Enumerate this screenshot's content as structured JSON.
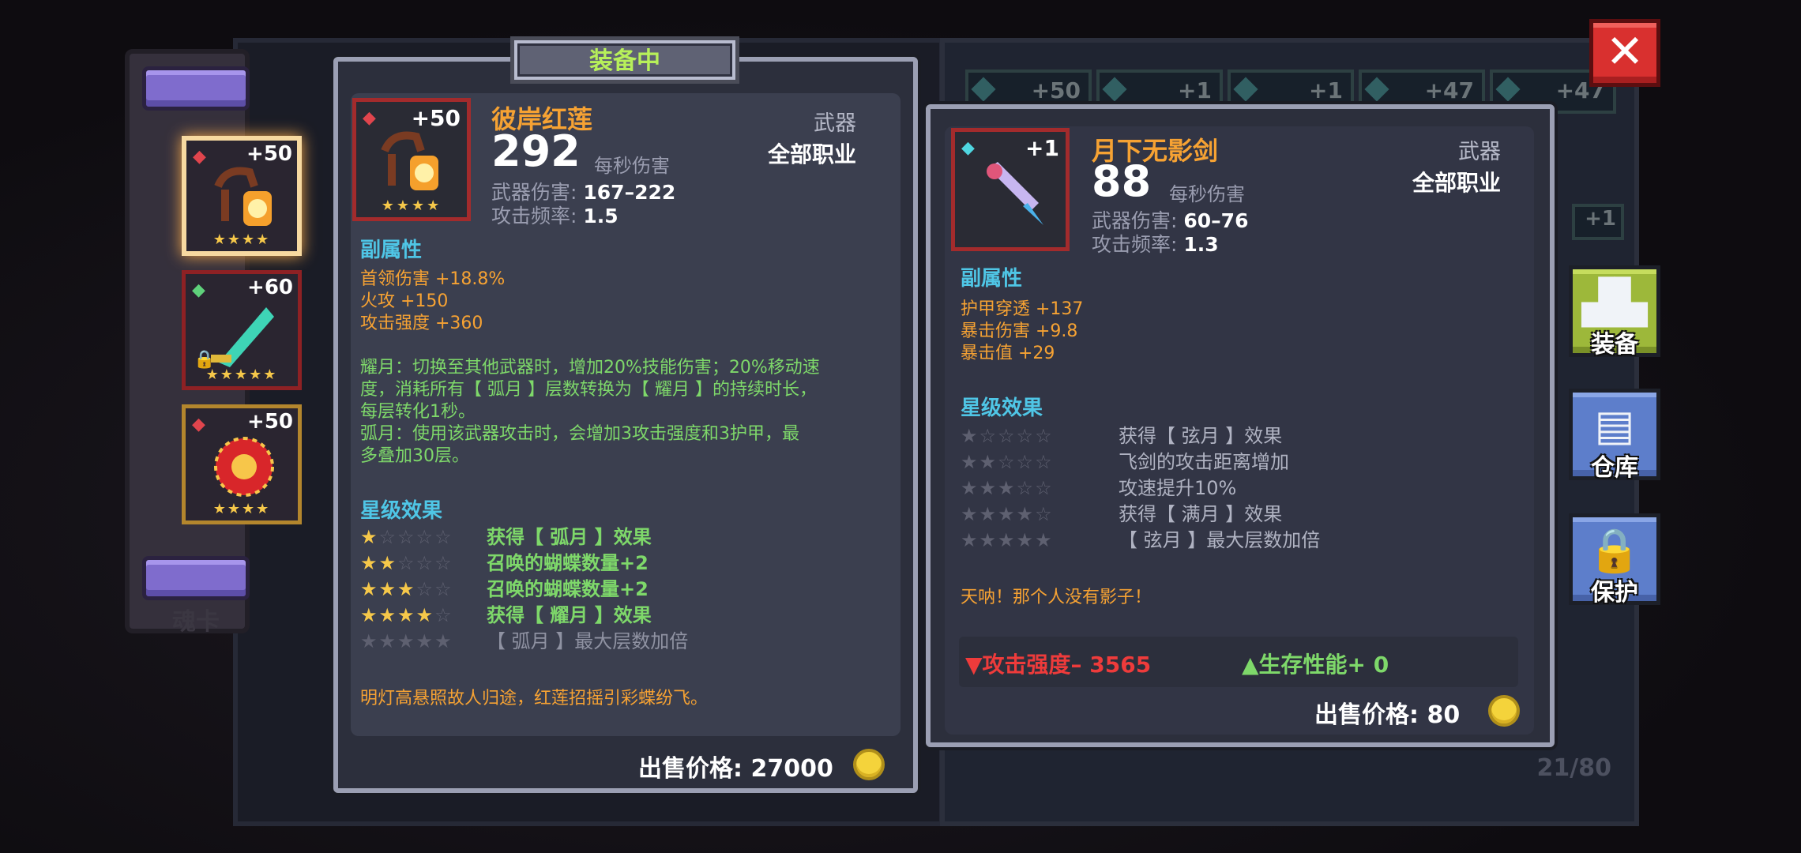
{
  "colors": {
    "orange": "#f6a233",
    "cyan": "#4fc6e6",
    "green": "#7ed86a",
    "red": "#ee3b3b",
    "gold": "#f6c84a"
  },
  "background": {
    "inventory_levels": [
      "+50",
      "+1",
      "+1",
      "+47",
      "+47"
    ],
    "side_level": "+1",
    "count": "21/80",
    "tab_label": "魂卡"
  },
  "slots": [
    {
      "level": "+50",
      "gem": "red-gem-icon",
      "stars": "★★★★",
      "icon": "lantern-staff-icon"
    },
    {
      "level": "+60",
      "gem": "green-gem-icon",
      "stars": "★★★★★",
      "icon": "jade-sword-icon"
    },
    {
      "level": "+50",
      "gem": "red-gem-icon",
      "stars": "★★★★",
      "icon": "red-orb-icon"
    }
  ],
  "equipped": {
    "header": "装备中",
    "name": "彼岸红莲",
    "level": "+50",
    "stars": "★★★★",
    "dps": "292",
    "dps_label": "每秒伤害",
    "damage_label": "武器伤害:",
    "damage": "167–222",
    "rate_label": "攻击频率:",
    "rate": "1.5",
    "type": "武器",
    "class": "全部职业",
    "sub_title": "副属性",
    "sub_attrs": [
      "首领伤害 +18.8%",
      "火攻 +150",
      "攻击强度 +360"
    ],
    "desc_lines": [
      "耀月：切换至其他武器时，增加20%技能伤害；20%移动速",
      "度，消耗所有【 弧月 】层数转换为【 耀月 】的持续时长，",
      "每层转化1秒。",
      "弧月：使用该武器攻击时，会增加3攻击强度和3护甲，最",
      "多叠加30层。"
    ],
    "star_title": "星级效果",
    "star_effects": [
      {
        "on": "★",
        "off": "☆☆☆☆",
        "text": "获得【 弧月 】效果"
      },
      {
        "on": "★★",
        "off": "☆☆☆",
        "text": "召唤的蝴蝶数量+2"
      },
      {
        "on": "★★★",
        "off": "☆☆",
        "text": "召唤的蝴蝶数量+2"
      },
      {
        "on": "★★★★",
        "off": "☆",
        "text": "获得【 耀月 】效果"
      },
      {
        "on": "",
        "off": "★★★★★",
        "text": "【 弧月 】最大层数加倍"
      }
    ],
    "flavor": "明灯高悬照故人归途，红莲招摇引彩蝶纷飞。",
    "price_label": "出售价格:",
    "price": "27000"
  },
  "compare": {
    "name": "月下无影剑",
    "level": "+1",
    "dps": "88",
    "dps_label": "每秒伤害",
    "damage_label": "武器伤害:",
    "damage": "60–76",
    "rate_label": "攻击频率:",
    "rate": "1.3",
    "type": "武器",
    "class": "全部职业",
    "sub_title": "副属性",
    "sub_attrs": [
      "护甲穿透 +137",
      "暴击伤害 +9.8",
      "暴击值 +29"
    ],
    "star_title": "星级效果",
    "star_effects": [
      {
        "on": "",
        "off": "★☆☆☆☆",
        "text": "获得【 弦月 】效果"
      },
      {
        "on": "",
        "off": "★★☆☆☆",
        "text": "飞剑的攻击距离增加"
      },
      {
        "on": "",
        "off": "★★★☆☆",
        "text": "攻速提升10%"
      },
      {
        "on": "",
        "off": "★★★★☆",
        "text": "获得【 满月 】效果"
      },
      {
        "on": "",
        "off": "★★★★★",
        "text": "【 弦月 】最大层数加倍"
      }
    ],
    "flavor": "天呐！那个人没有影子！",
    "attack_diff": "▼攻击强度– 3565",
    "survive_diff": "▲生存性能+ 0",
    "price_label": "出售价格:",
    "price": "80"
  },
  "side_buttons": {
    "close": "✕",
    "equip": "装备",
    "warehouse": "仓库",
    "protect": "保护"
  }
}
